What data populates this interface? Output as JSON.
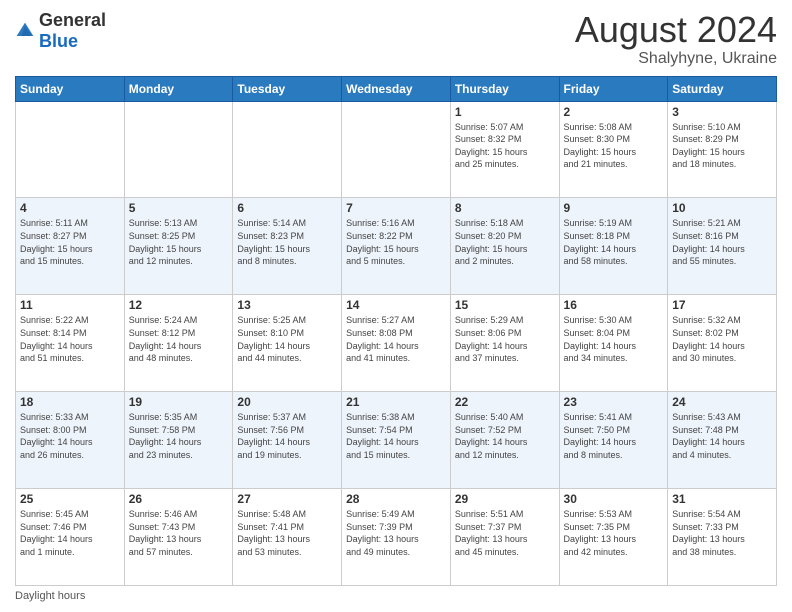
{
  "logo": {
    "general": "General",
    "blue": "Blue"
  },
  "header": {
    "month": "August 2024",
    "location": "Shalyhyne, Ukraine"
  },
  "footer": {
    "label": "Daylight hours"
  },
  "weekdays": [
    "Sunday",
    "Monday",
    "Tuesday",
    "Wednesday",
    "Thursday",
    "Friday",
    "Saturday"
  ],
  "weeks": [
    [
      {
        "day": "",
        "info": ""
      },
      {
        "day": "",
        "info": ""
      },
      {
        "day": "",
        "info": ""
      },
      {
        "day": "",
        "info": ""
      },
      {
        "day": "1",
        "info": "Sunrise: 5:07 AM\nSunset: 8:32 PM\nDaylight: 15 hours\nand 25 minutes."
      },
      {
        "day": "2",
        "info": "Sunrise: 5:08 AM\nSunset: 8:30 PM\nDaylight: 15 hours\nand 21 minutes."
      },
      {
        "day": "3",
        "info": "Sunrise: 5:10 AM\nSunset: 8:29 PM\nDaylight: 15 hours\nand 18 minutes."
      }
    ],
    [
      {
        "day": "4",
        "info": "Sunrise: 5:11 AM\nSunset: 8:27 PM\nDaylight: 15 hours\nand 15 minutes."
      },
      {
        "day": "5",
        "info": "Sunrise: 5:13 AM\nSunset: 8:25 PM\nDaylight: 15 hours\nand 12 minutes."
      },
      {
        "day": "6",
        "info": "Sunrise: 5:14 AM\nSunset: 8:23 PM\nDaylight: 15 hours\nand 8 minutes."
      },
      {
        "day": "7",
        "info": "Sunrise: 5:16 AM\nSunset: 8:22 PM\nDaylight: 15 hours\nand 5 minutes."
      },
      {
        "day": "8",
        "info": "Sunrise: 5:18 AM\nSunset: 8:20 PM\nDaylight: 15 hours\nand 2 minutes."
      },
      {
        "day": "9",
        "info": "Sunrise: 5:19 AM\nSunset: 8:18 PM\nDaylight: 14 hours\nand 58 minutes."
      },
      {
        "day": "10",
        "info": "Sunrise: 5:21 AM\nSunset: 8:16 PM\nDaylight: 14 hours\nand 55 minutes."
      }
    ],
    [
      {
        "day": "11",
        "info": "Sunrise: 5:22 AM\nSunset: 8:14 PM\nDaylight: 14 hours\nand 51 minutes."
      },
      {
        "day": "12",
        "info": "Sunrise: 5:24 AM\nSunset: 8:12 PM\nDaylight: 14 hours\nand 48 minutes."
      },
      {
        "day": "13",
        "info": "Sunrise: 5:25 AM\nSunset: 8:10 PM\nDaylight: 14 hours\nand 44 minutes."
      },
      {
        "day": "14",
        "info": "Sunrise: 5:27 AM\nSunset: 8:08 PM\nDaylight: 14 hours\nand 41 minutes."
      },
      {
        "day": "15",
        "info": "Sunrise: 5:29 AM\nSunset: 8:06 PM\nDaylight: 14 hours\nand 37 minutes."
      },
      {
        "day": "16",
        "info": "Sunrise: 5:30 AM\nSunset: 8:04 PM\nDaylight: 14 hours\nand 34 minutes."
      },
      {
        "day": "17",
        "info": "Sunrise: 5:32 AM\nSunset: 8:02 PM\nDaylight: 14 hours\nand 30 minutes."
      }
    ],
    [
      {
        "day": "18",
        "info": "Sunrise: 5:33 AM\nSunset: 8:00 PM\nDaylight: 14 hours\nand 26 minutes."
      },
      {
        "day": "19",
        "info": "Sunrise: 5:35 AM\nSunset: 7:58 PM\nDaylight: 14 hours\nand 23 minutes."
      },
      {
        "day": "20",
        "info": "Sunrise: 5:37 AM\nSunset: 7:56 PM\nDaylight: 14 hours\nand 19 minutes."
      },
      {
        "day": "21",
        "info": "Sunrise: 5:38 AM\nSunset: 7:54 PM\nDaylight: 14 hours\nand 15 minutes."
      },
      {
        "day": "22",
        "info": "Sunrise: 5:40 AM\nSunset: 7:52 PM\nDaylight: 14 hours\nand 12 minutes."
      },
      {
        "day": "23",
        "info": "Sunrise: 5:41 AM\nSunset: 7:50 PM\nDaylight: 14 hours\nand 8 minutes."
      },
      {
        "day": "24",
        "info": "Sunrise: 5:43 AM\nSunset: 7:48 PM\nDaylight: 14 hours\nand 4 minutes."
      }
    ],
    [
      {
        "day": "25",
        "info": "Sunrise: 5:45 AM\nSunset: 7:46 PM\nDaylight: 14 hours\nand 1 minute."
      },
      {
        "day": "26",
        "info": "Sunrise: 5:46 AM\nSunset: 7:43 PM\nDaylight: 13 hours\nand 57 minutes."
      },
      {
        "day": "27",
        "info": "Sunrise: 5:48 AM\nSunset: 7:41 PM\nDaylight: 13 hours\nand 53 minutes."
      },
      {
        "day": "28",
        "info": "Sunrise: 5:49 AM\nSunset: 7:39 PM\nDaylight: 13 hours\nand 49 minutes."
      },
      {
        "day": "29",
        "info": "Sunrise: 5:51 AM\nSunset: 7:37 PM\nDaylight: 13 hours\nand 45 minutes."
      },
      {
        "day": "30",
        "info": "Sunrise: 5:53 AM\nSunset: 7:35 PM\nDaylight: 13 hours\nand 42 minutes."
      },
      {
        "day": "31",
        "info": "Sunrise: 5:54 AM\nSunset: 7:33 PM\nDaylight: 13 hours\nand 38 minutes."
      }
    ]
  ]
}
